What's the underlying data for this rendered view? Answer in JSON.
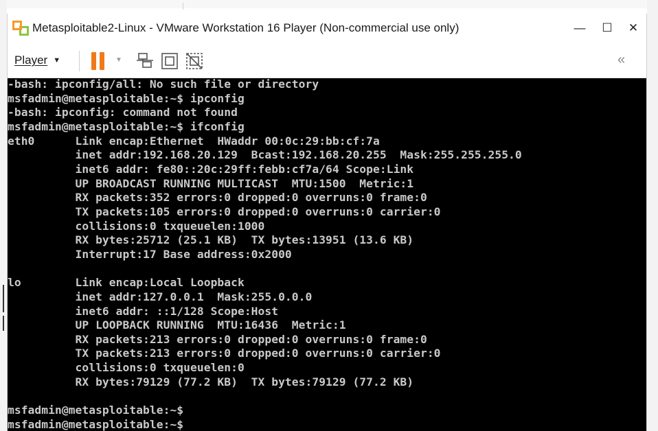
{
  "window": {
    "title": "Metasploitable2-Linux - VMware Workstation 16 Player (Non-commercial use only)",
    "minimize_glyph": "—",
    "maximize_glyph": "☐",
    "close_glyph": "✕",
    "app_icon": "vmware-player-icon"
  },
  "toolbar": {
    "player_label": "Player",
    "player_caret": "▼",
    "pause_caret": "▼",
    "collapse_glyph": "«",
    "icons": [
      "pause-icon",
      "network-icon",
      "fit-guest-icon",
      "unity-icon",
      "collapse-toolbar-icon"
    ],
    "accent": "#f07a1a"
  },
  "console": {
    "background": "#000000",
    "foreground": "#c9c9c9",
    "lines": [
      "-bash: ipconfig/all: No such file or directory",
      "msfadmin@metasploitable:~$ ipconfig",
      "-bash: ipconfig: command not found",
      "msfadmin@metasploitable:~$ ifconfig",
      "eth0      Link encap:Ethernet  HWaddr 00:0c:29:bb:cf:7a",
      "          inet addr:192.168.20.129  Bcast:192.168.20.255  Mask:255.255.255.0",
      "          inet6 addr: fe80::20c:29ff:febb:cf7a/64 Scope:Link",
      "          UP BROADCAST RUNNING MULTICAST  MTU:1500  Metric:1",
      "          RX packets:352 errors:0 dropped:0 overruns:0 frame:0",
      "          TX packets:105 errors:0 dropped:0 overruns:0 carrier:0",
      "          collisions:0 txqueuelen:1000",
      "          RX bytes:25712 (25.1 KB)  TX bytes:13951 (13.6 KB)",
      "          Interrupt:17 Base address:0x2000",
      "",
      "lo        Link encap:Local Loopback",
      "          inet addr:127.0.0.1  Mask:255.0.0.0",
      "          inet6 addr: ::1/128 Scope:Host",
      "          UP LOOPBACK RUNNING  MTU:16436  Metric:1",
      "          RX packets:213 errors:0 dropped:0 overruns:0 frame:0",
      "          TX packets:213 errors:0 dropped:0 overruns:0 carrier:0",
      "          collisions:0 txqueuelen:0",
      "          RX bytes:79129 (77.2 KB)  TX bytes:79129 (77.2 KB)",
      "",
      "msfadmin@metasploitable:~$",
      "msfadmin@metasploitable:~$"
    ]
  }
}
